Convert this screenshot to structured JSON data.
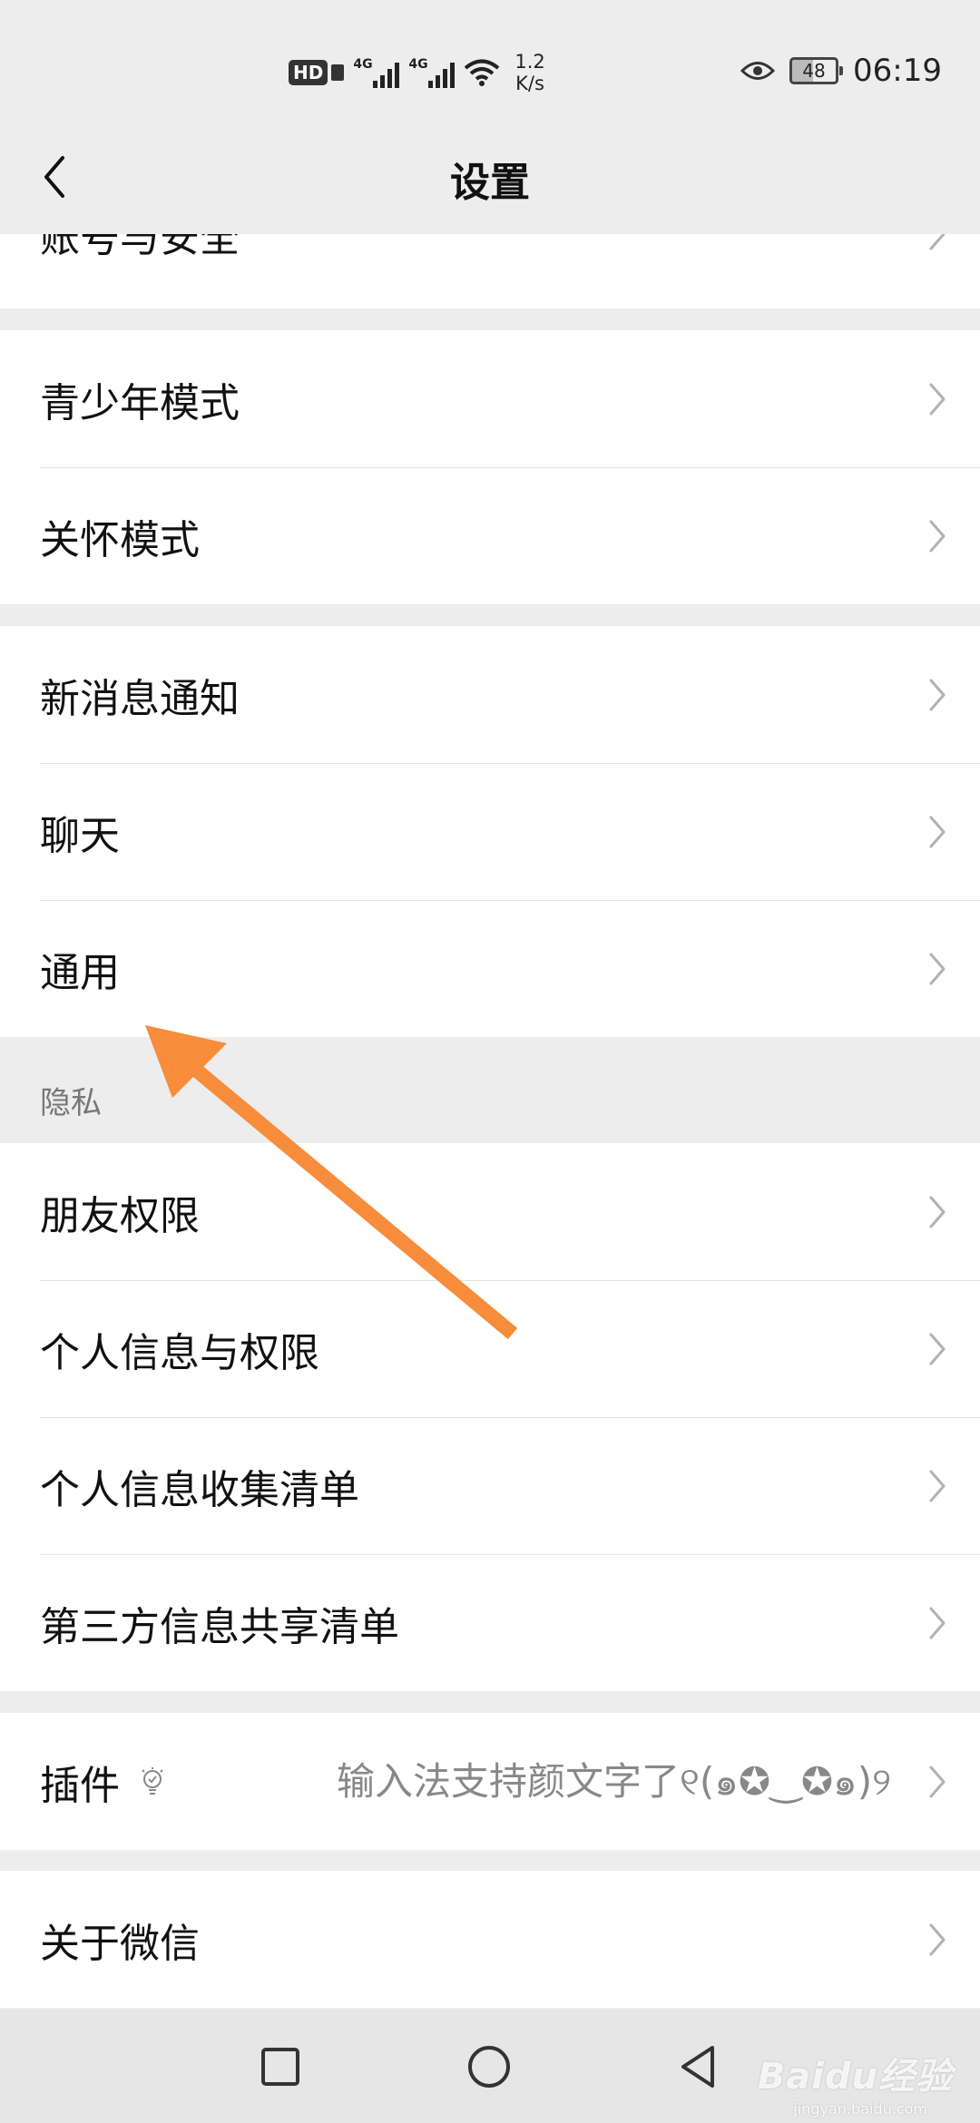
{
  "status_bar": {
    "hd": "HD",
    "net1": "4G",
    "net2": "4G",
    "speed_value": "1.2",
    "speed_unit": "K/s",
    "battery": "48",
    "time": "06:19"
  },
  "header": {
    "title": "设置"
  },
  "groups": {
    "account": {
      "label": "账号与安全"
    },
    "youth": {
      "label": "青少年模式"
    },
    "care": {
      "label": "关怀模式"
    },
    "notify": {
      "label": "新消息通知"
    },
    "chat": {
      "label": "聊天"
    },
    "general": {
      "label": "通用"
    },
    "privacy_section": {
      "label": "隐私"
    },
    "friend_perm": {
      "label": "朋友权限"
    },
    "personal_info": {
      "label": "个人信息与权限"
    },
    "info_collect": {
      "label": "个人信息收集清单"
    },
    "third_party": {
      "label": "第三方信息共享清单"
    },
    "plugins": {
      "label": "插件",
      "hint": "输入法支持颜文字了୧(๑✪‿✪๑)୨"
    },
    "about": {
      "label": "关于微信"
    }
  },
  "watermark": {
    "brand": "Baidu经验",
    "url": "jingyan.baidu.com"
  },
  "colors": {
    "background": "#ededed",
    "annotation_arrow": "#f78c3a"
  }
}
